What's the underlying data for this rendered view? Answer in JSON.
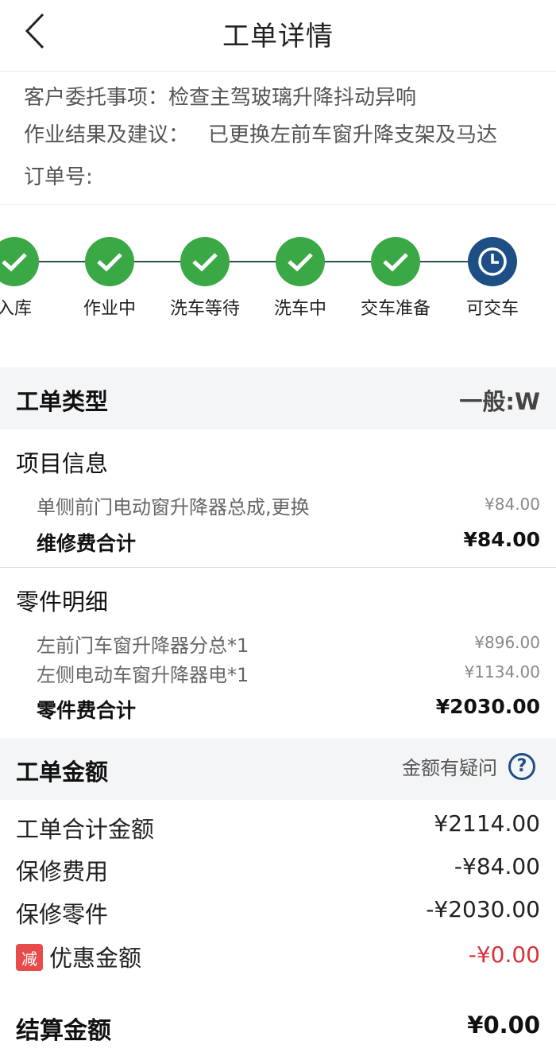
{
  "header": {
    "title": "工单详情"
  },
  "info": {
    "entrust_label": "客户委托事项：",
    "entrust_value": "检查主驾玻璃升降抖动异响",
    "result_label": "作业结果及建议：",
    "result_value": "已更换左前车窗升降支架及马达",
    "order_label": "订单号:"
  },
  "steps": [
    {
      "label": "入库",
      "state": "done"
    },
    {
      "label": "作业中",
      "state": "done"
    },
    {
      "label": "洗车等待",
      "state": "done"
    },
    {
      "label": "洗车中",
      "state": "done"
    },
    {
      "label": "交车准备",
      "state": "done"
    },
    {
      "label": "可交车",
      "state": "current"
    }
  ],
  "order_type": {
    "label": "工单类型",
    "value": "一般:W"
  },
  "project": {
    "title": "项目信息",
    "items": [
      {
        "name": "单侧前门电动窗升降器总成,更换",
        "price": "¥84.00"
      }
    ],
    "subtotal_label": "维修费合计",
    "subtotal_value": "¥84.00"
  },
  "parts": {
    "title": "零件明细",
    "items": [
      {
        "name": "左前门车窗升降器分总*1",
        "price": "¥896.00"
      },
      {
        "name": "左侧电动车窗升降器电*1",
        "price": "¥1134.00"
      }
    ],
    "subtotal_label": "零件费合计",
    "subtotal_value": "¥2030.00"
  },
  "amount": {
    "title": "工单金额",
    "doubt_label": "金额有疑问",
    "rows": [
      {
        "label": "工单合计金额",
        "value": "¥2114.00"
      },
      {
        "label": "保修费用",
        "value": "-¥84.00"
      },
      {
        "label": "保修零件",
        "value": "-¥2030.00"
      },
      {
        "label": "优惠金额",
        "value": "-¥0.00",
        "badge": "减"
      }
    ],
    "settle_label": "结算金额",
    "settle_value": "¥0.00"
  },
  "colors": {
    "done": "#39a845",
    "current": "#1d4f86",
    "discount": "#d9323a"
  }
}
